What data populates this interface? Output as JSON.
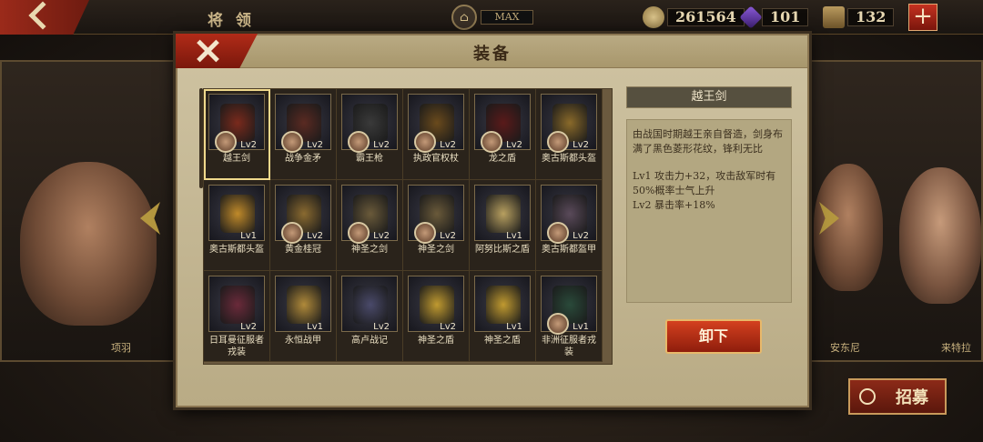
{
  "topbar": {
    "title": "将 领",
    "max_label": "MAX",
    "coins": "261564",
    "gems": "101",
    "crates": "132",
    "plus_label": "+"
  },
  "heroes": {
    "left_name": "项羽",
    "right_name_1": "安东尼",
    "right_name_2": "来特拉"
  },
  "recruit_label": "招募",
  "modal": {
    "title": "装备",
    "items": [
      {
        "name": "越王剑",
        "level": "Lv2",
        "color": "#7a2a1c",
        "portrait": true,
        "selected": true
      },
      {
        "name": "战争金矛",
        "level": "Lv2",
        "color": "#5a2a22",
        "portrait": true
      },
      {
        "name": "霸王枪",
        "level": "Lv2",
        "color": "#3a3a3a",
        "portrait": true
      },
      {
        "name": "执政官权杖",
        "level": "Lv2",
        "color": "#6a4a1c",
        "portrait": true
      },
      {
        "name": "龙之盾",
        "level": "Lv2",
        "color": "#5a1a1a",
        "portrait": true
      },
      {
        "name": "奥古斯都头盔",
        "level": "Lv2",
        "color": "#8a6a2a",
        "portrait": true
      },
      {
        "name": "奥古斯都头盔",
        "level": "Lv1",
        "color": "#c08a2a",
        "portrait": false
      },
      {
        "name": "黄金桂冠",
        "level": "Lv2",
        "color": "#8a6a30",
        "portrait": true
      },
      {
        "name": "神圣之剑",
        "level": "Lv2",
        "color": "#6a5a3a",
        "portrait": true
      },
      {
        "name": "神圣之剑",
        "level": "Lv2",
        "color": "#6a5a3a",
        "portrait": true
      },
      {
        "name": "阿努比斯之盾",
        "level": "Lv1",
        "color": "#b8a060",
        "portrait": false
      },
      {
        "name": "奥古斯都盔甲",
        "level": "Lv2",
        "color": "#5a4a5a",
        "portrait": true
      },
      {
        "name": "日耳曼征服者戎装",
        "level": "Lv2",
        "color": "#6a2a3a",
        "portrait": false
      },
      {
        "name": "永恒战甲",
        "level": "Lv1",
        "color": "#b08a3a",
        "portrait": false
      },
      {
        "name": "高卢战记",
        "level": "Lv2",
        "color": "#4a4a6a",
        "portrait": false
      },
      {
        "name": "神圣之盾",
        "level": "Lv2",
        "color": "#c09a30",
        "portrait": false
      },
      {
        "name": "神圣之盾",
        "level": "Lv1",
        "color": "#c09a30",
        "portrait": false
      },
      {
        "name": "非洲征服者戎装",
        "level": "Lv1",
        "color": "#2a4a3a",
        "portrait": true
      }
    ],
    "detail": {
      "title": "越王剑",
      "description": "由战国时期越王亲自督造，剑身布满了黑色菱形花纹，锋利无比",
      "effect1": "Lv1  攻击力+32，攻击敌军时有50%概率士气上升",
      "effect2": "Lv2  暴击率+18%"
    },
    "unequip_label": "卸下"
  }
}
